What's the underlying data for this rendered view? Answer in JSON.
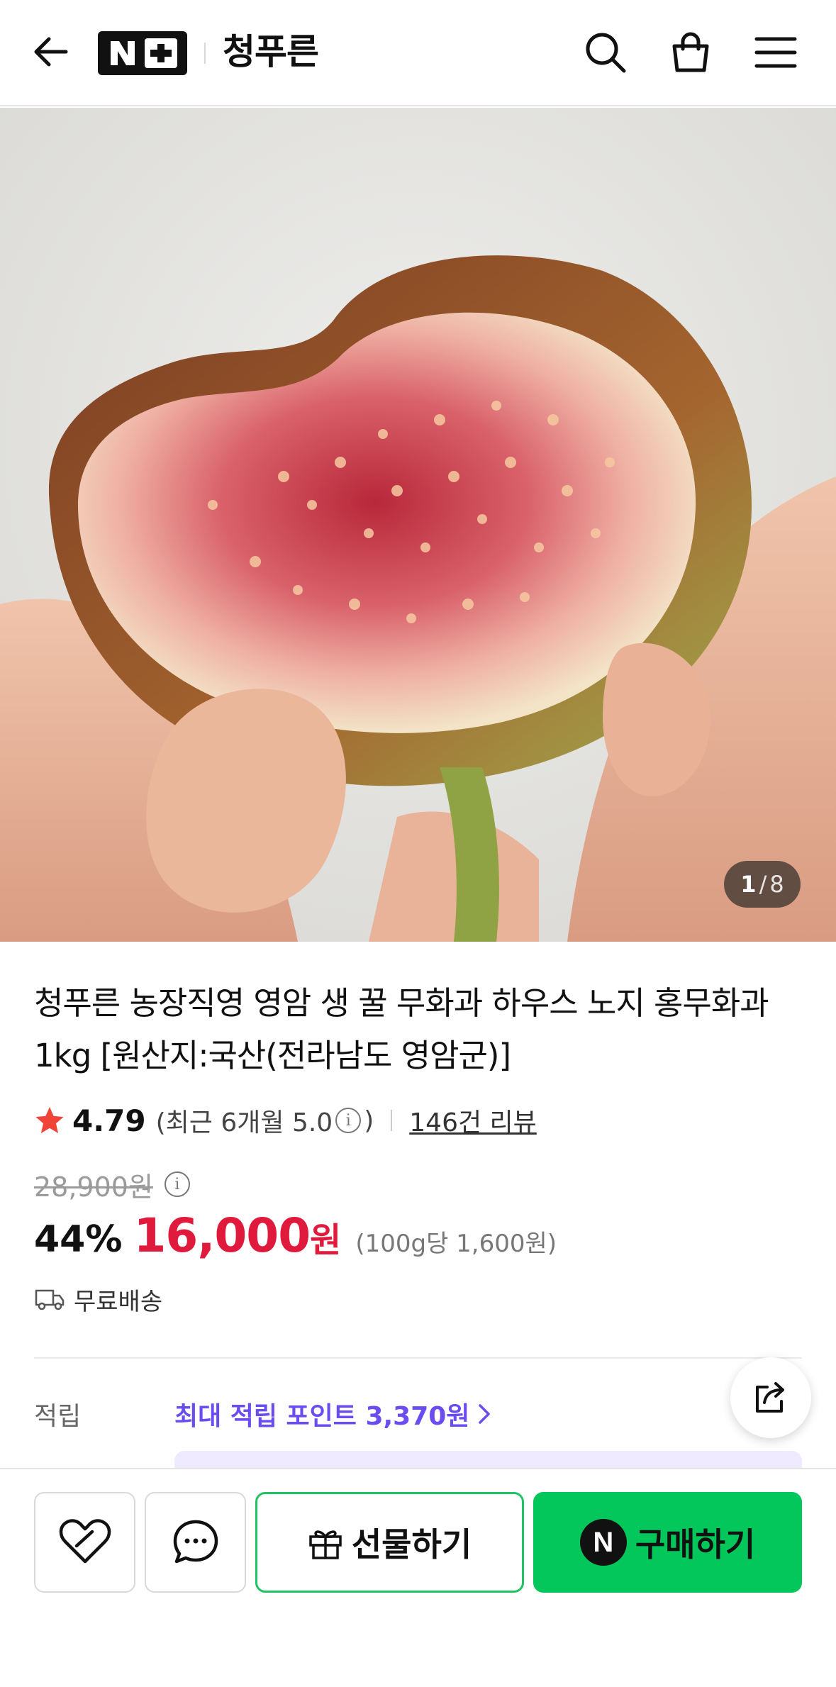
{
  "header": {
    "logo_text": "N+",
    "store_name": "청푸른"
  },
  "gallery": {
    "current": "1",
    "separator": "/",
    "total": "8"
  },
  "product": {
    "title": "청푸른 농장직영 영암 생 꿀 무화과 하우스 노지 홍무화과 1kg [원산지:국산(전라남도 영암군)]",
    "rating": "4.79",
    "recent_prefix": "(최근 6개월 5.0",
    "recent_suffix": ")",
    "review_count": "146건 리뷰",
    "original_price": "28,900원",
    "discount": "44%",
    "price": "16,000",
    "currency": "원",
    "unit_price": "(100g당 1,600원)",
    "delivery": "무료배송"
  },
  "points": {
    "label": "적립",
    "value": "최대 적립 포인트 3,370원"
  },
  "bottom_bar": {
    "gift_label": "선물하기",
    "buy_label": "구매하기",
    "buy_badge": "N"
  },
  "colors": {
    "price_red": "#e01a3c",
    "naver_green": "#03c75a",
    "points_purple": "#6a4cf0"
  }
}
